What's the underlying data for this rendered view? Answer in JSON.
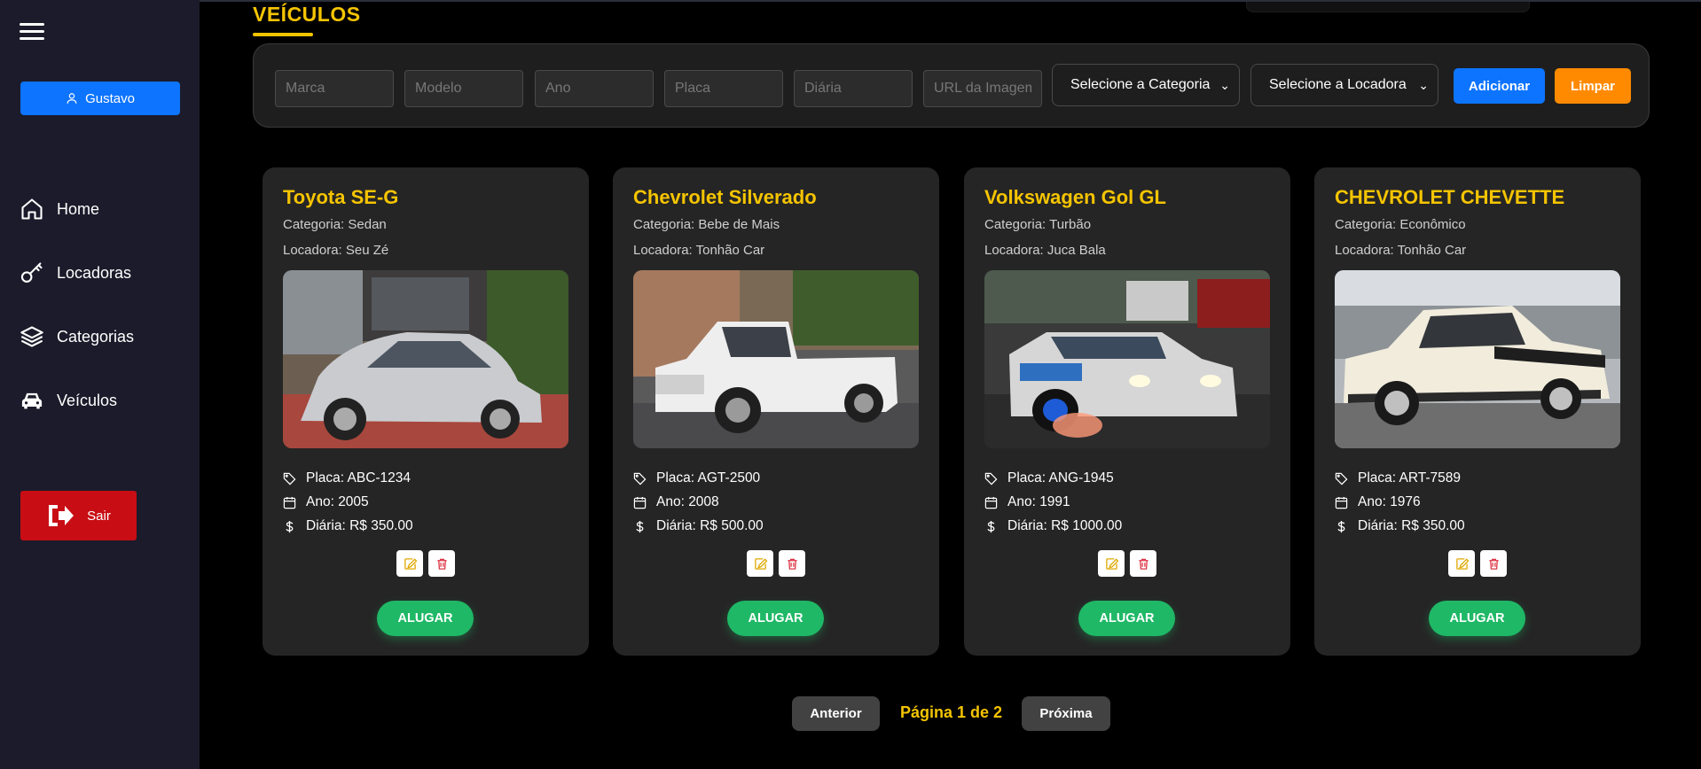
{
  "sidebar": {
    "user_name": "Gustavo",
    "nav": [
      {
        "label": "Home",
        "icon": "home-icon"
      },
      {
        "label": "Locadoras",
        "icon": "key-icon"
      },
      {
        "label": "Categorias",
        "icon": "layers-icon"
      },
      {
        "label": "Veículos",
        "icon": "car-icon"
      }
    ],
    "logout_label": "Sair"
  },
  "header": {
    "title": "VEÍCULOS"
  },
  "form": {
    "placeholders": {
      "marca": "Marca",
      "modelo": "Modelo",
      "ano": "Ano",
      "placa": "Placa",
      "diaria": "Diária",
      "url": "URL da Imagem"
    },
    "category_select": "Selecione a Categoria",
    "rental_select": "Selecione a Locadora",
    "add_label": "Adicionar",
    "clear_label": "Limpar"
  },
  "vehicles": [
    {
      "title": "Toyota SE-G",
      "categoria": "Categoria: Sedan",
      "locadora": "Locadora: Seu Zé",
      "placa": "Placa: ABC-1234",
      "ano": "Ano: 2005",
      "diaria": "Diária: R$ 350.00",
      "rent_label": "ALUGAR",
      "body_color": "#c9cbcf"
    },
    {
      "title": "Chevrolet Silverado",
      "categoria": "Categoria: Bebe de Mais",
      "locadora": "Locadora: Tonhão Car",
      "placa": "Placa: AGT-2500",
      "ano": "Ano: 2008",
      "diaria": "Diária: R$ 500.00",
      "rent_label": "ALUGAR",
      "body_color": "#eeeeee"
    },
    {
      "title": "Volkswagen Gol GL",
      "categoria": "Categoria: Turbão",
      "locadora": "Locadora: Juca Bala",
      "placa": "Placa: ANG-1945",
      "ano": "Ano: 1991",
      "diaria": "Diária: R$ 1000.00",
      "rent_label": "ALUGAR",
      "body_color": "#d6d6d6"
    },
    {
      "title": "CHEVROLET CHEVETTE",
      "categoria": "Categoria: Econômico",
      "locadora": "Locadora: Tonhão Car",
      "placa": "Placa: ART-7589",
      "ano": "Ano: 1976",
      "diaria": "Diária: R$ 350.00",
      "rent_label": "ALUGAR",
      "body_color": "#f1ecdc"
    }
  ],
  "pagination": {
    "prev_label": "Anterior",
    "page_text": "Página 1 de 2",
    "next_label": "Próxima"
  },
  "colors": {
    "accent": "#f5c400",
    "primary": "#0d74ff",
    "danger": "#c80e14",
    "warning": "#ff8a00",
    "success": "#1fb866"
  }
}
